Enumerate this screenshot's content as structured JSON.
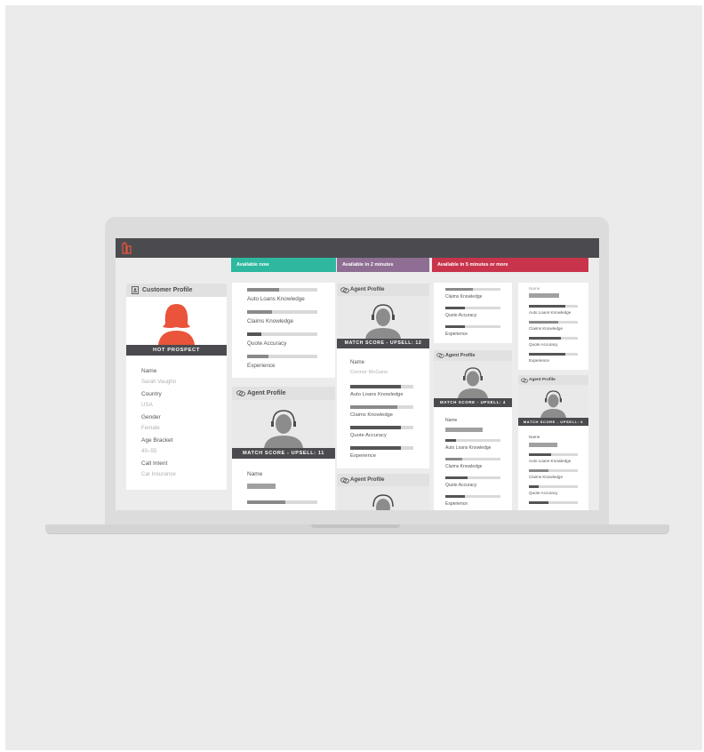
{
  "columns": {
    "now": "Available now",
    "two_min": "Available in 2 minutes",
    "five_min": "Available in 5 minutes or more"
  },
  "colors": {
    "now": "#2eb8a0",
    "two_min": "#8f6e93",
    "five_min": "#c8344c",
    "hot": "#e9543a",
    "dark": "#4b4b4f"
  },
  "customer": {
    "title": "Customer Profile",
    "badge": "HOT PROSPECT",
    "fields": [
      {
        "label": "Name",
        "value": "Sarah Vaughn"
      },
      {
        "label": "Country",
        "value": "USA"
      },
      {
        "label": "Gender",
        "value": "Female"
      },
      {
        "label": "Age Bracket",
        "value": "40–55"
      },
      {
        "label": "Call Intent",
        "value": "Car Insurance"
      }
    ]
  },
  "now_col": {
    "skills": [
      {
        "label": "Auto Loans Knowledge",
        "level": 0.45
      },
      {
        "label": "Claims Knowledge",
        "level": 0.35
      },
      {
        "label": "Quote Accuracy",
        "level": 0.2
      },
      {
        "label": "Experience",
        "level": 0.3
      }
    ],
    "agent": {
      "title": "Agent Profile",
      "match": "MATCH SCORE - UPSELL: 11",
      "name_label": "Name",
      "skills": [
        {
          "label": "Auto Loans Knowledge",
          "level": 0.55
        }
      ]
    }
  },
  "two_col": {
    "agent1": {
      "title": "Agent Profile",
      "match": "MATCH SCORE - UPSELL: 12",
      "name_label": "Name",
      "name_value": "Connor McGann",
      "skills": [
        {
          "label": "Auto Loans Knowledge",
          "level": 0.8
        },
        {
          "label": "Claims Knowledge",
          "level": 0.75
        },
        {
          "label": "Quote Accuracy",
          "level": 0.8
        },
        {
          "label": "Experience",
          "level": 0.8
        }
      ]
    },
    "agent2": {
      "title": "Agent Profile"
    }
  },
  "five_col_a": {
    "skills": [
      {
        "label": "Claims Knowledge",
        "level": 0.5
      },
      {
        "label": "Quote Accuracy",
        "level": 0.35
      },
      {
        "label": "Experience",
        "level": 0.35
      }
    ],
    "agent": {
      "title": "Agent Profile",
      "match": "MATCH SCORE - UPSELL: 4",
      "name_label": "Name",
      "skills": [
        {
          "label": "Auto Loans Knowledge",
          "level": 0.2
        },
        {
          "label": "Claims Knowledge",
          "level": 0.3
        },
        {
          "label": "Quote Accuracy",
          "level": 0.4
        },
        {
          "label": "Experience",
          "level": 0.35
        }
      ]
    }
  },
  "five_col_b": {
    "name_label": "Name",
    "skills": [
      {
        "label": "Auto Loans Knowledge",
        "level": 0.75
      },
      {
        "label": "Claims Knowledge",
        "level": 0.6
      },
      {
        "label": "Quote Accuracy",
        "level": 0.65
      },
      {
        "label": "Experience",
        "level": 0.75
      }
    ],
    "agent": {
      "title": "Agent Profile",
      "match": "MATCH SCORE - UPSELL: 6",
      "name_label": "Name",
      "skills": [
        {
          "label": "Auto Loans Knowledge",
          "level": 0.45
        },
        {
          "label": "Claims Knowledge",
          "level": 0.4
        },
        {
          "label": "Quote Accuracy",
          "level": 0.2
        },
        {
          "label": "",
          "level": 0.4
        }
      ]
    }
  }
}
